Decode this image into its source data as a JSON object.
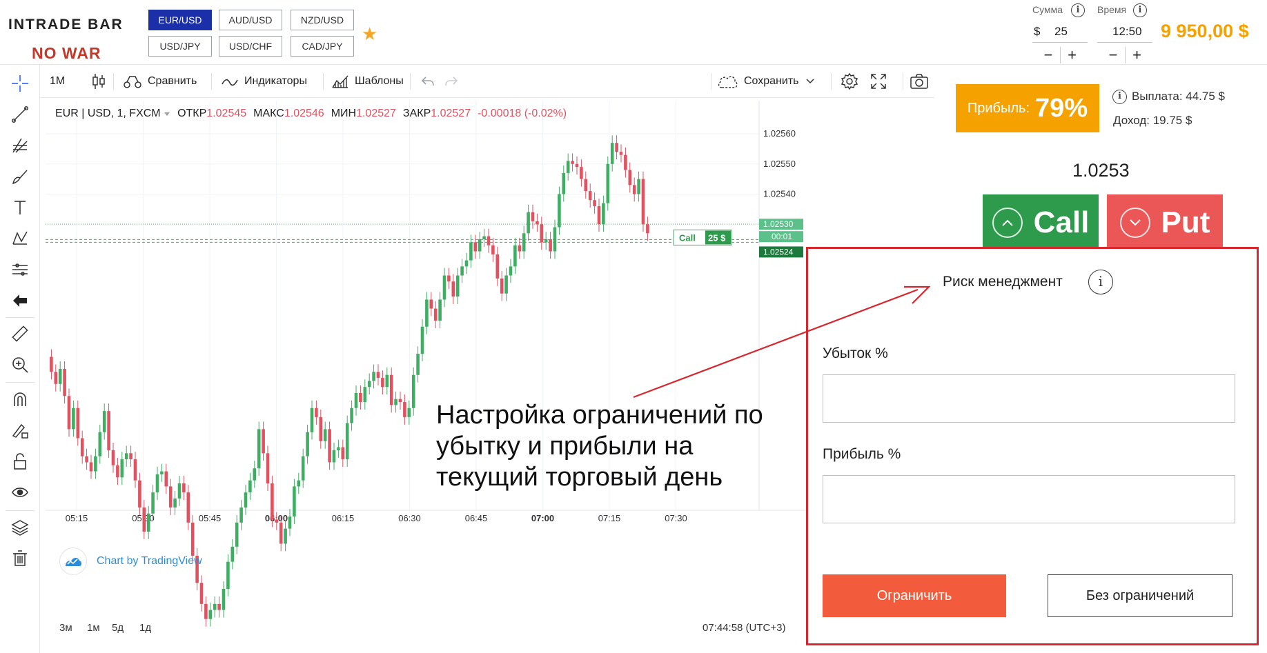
{
  "header": {
    "logo_text": "INTRADE BAR",
    "logo_tagline": "NO WAR",
    "pairs": [
      {
        "label": "EUR/USD",
        "active": true
      },
      {
        "label": "AUD/USD",
        "active": false
      },
      {
        "label": "NZD/USD",
        "active": false
      },
      {
        "label": "USD/JPY",
        "active": false
      },
      {
        "label": "USD/CHF",
        "active": false
      },
      {
        "label": "CAD/JPY",
        "active": false
      }
    ],
    "amount_label": "Сумма",
    "amount_currency": "$",
    "amount_value": "25",
    "time_label": "Время",
    "time_value": "12:50",
    "minus": "−",
    "plus": "+",
    "balance": "9 950,00 $"
  },
  "chart_toolbar": {
    "interval": "1M",
    "compare": "Сравнить",
    "indicators": "Индикаторы",
    "templates": "Шаблоны",
    "save": "Сохранить"
  },
  "chart_legend": {
    "symbol": "EUR | USD, 1, FXCM",
    "open_label": "ОТКР",
    "open": "1.02545",
    "high_label": "МАКС",
    "high": "1.02546",
    "low_label": "МИН",
    "low": "1.02527",
    "close_label": "ЗАКР",
    "close": "1.02527",
    "change": "-0.00018 (-0.02%)"
  },
  "chart_data": {
    "type": "candlestick",
    "x_ticks": [
      "05:15",
      "05:30",
      "05:45",
      "06:00",
      "06:15",
      "06:30",
      "06:45",
      "07:00",
      "07:15",
      "07:30"
    ],
    "y_ticks": [
      "1.02560",
      "1.02550",
      "1.02540"
    ],
    "price_labels": {
      "current": "1.02530",
      "countdown": "00:01",
      "entry": "1.02524"
    },
    "ylim": [
      1.02436,
      1.02571
    ],
    "trade_marker": {
      "label": "Call",
      "amount": "25 $"
    },
    "close_path": [
      1.02486,
      1.02481,
      1.02477,
      1.02482,
      1.02473,
      1.02462,
      1.02469,
      1.02459,
      1.02453,
      1.02451,
      1.02448,
      1.02453,
      1.02461,
      1.02468,
      1.02455,
      1.0245,
      1.02446,
      1.02452,
      1.02454,
      1.02452,
      1.02445,
      1.02436,
      1.02428,
      1.02434,
      1.02441,
      1.02447,
      1.02448,
      1.02443,
      1.02436,
      1.02439,
      1.02444,
      1.02441,
      1.02431,
      1.0242,
      1.02411,
      1.02404,
      1.02399,
      1.02402,
      1.02404,
      1.02402,
      1.02409,
      1.02418,
      1.02423,
      1.02431,
      1.02436,
      1.02441,
      1.02445,
      1.02449,
      1.02462,
      1.02454,
      1.02444,
      1.02432,
      1.02431,
      1.02424,
      1.02429,
      1.02433,
      1.02443,
      1.02445,
      1.02453,
      1.02461,
      1.02469,
      1.02466,
      1.02458,
      1.02462,
      1.02451,
      1.02455,
      1.02456,
      1.02452,
      1.02464,
      1.02469,
      1.02474,
      1.02471,
      1.02476,
      1.02478,
      1.02481,
      1.02479,
      1.02476,
      1.0248,
      1.0247,
      1.02472,
      1.02471,
      1.02466,
      1.02469,
      1.0248,
      1.02487,
      1.02496,
      1.02505,
      1.02502,
      1.02498,
      1.02505,
      1.02513,
      1.02511,
      1.02506,
      1.02513,
      1.02516,
      1.02518,
      1.02524,
      1.02521,
      1.02525,
      1.02526,
      1.02523,
      1.0252,
      1.02512,
      1.02507,
      1.02513,
      1.02516,
      1.02523,
      1.02521,
      1.02527,
      1.02534,
      1.02531,
      1.0253,
      1.02524,
      1.02525,
      1.02521,
      1.02529,
      1.0254,
      1.02547,
      1.02551,
      1.0255,
      1.02549,
      1.02545,
      1.02541,
      1.02538,
      1.02536,
      1.0253,
      1.02537,
      1.0255,
      1.02557,
      1.02554,
      1.02553,
      1.02548,
      1.02543,
      1.0254,
      1.02545,
      1.0253,
      1.02527
    ]
  },
  "chart_footer": {
    "ranges": [
      "3м",
      "1м",
      "5д",
      "1д"
    ],
    "clock": "07:44:58 (UTC+3)",
    "watermark": "Chart by TradingView"
  },
  "trade": {
    "profit_label": "Прибыль:",
    "profit_pct": "79%",
    "payout": "Выплата: 44.75 $",
    "income": "Доход: 19.75 $",
    "price": "1.0253",
    "call": "Call",
    "put": "Put"
  },
  "risk": {
    "title": "Риск менеджмент",
    "loss_label": "Убыток %",
    "loss_value": "",
    "profit_label": "Прибыль %",
    "profit_value": "",
    "limit_button": "Ограничить",
    "no_limit_button": "Без ограничений"
  },
  "annotation": {
    "text": "Настройка ограничений по убытку и прибыли на текущий торговый день"
  },
  "colors": {
    "up": "#3fae63",
    "down": "#e05260",
    "accent_orange": "#f5a100",
    "call_green": "#2e9a4b",
    "put_red": "#eb5757",
    "annotation_red": "#d8262e"
  }
}
